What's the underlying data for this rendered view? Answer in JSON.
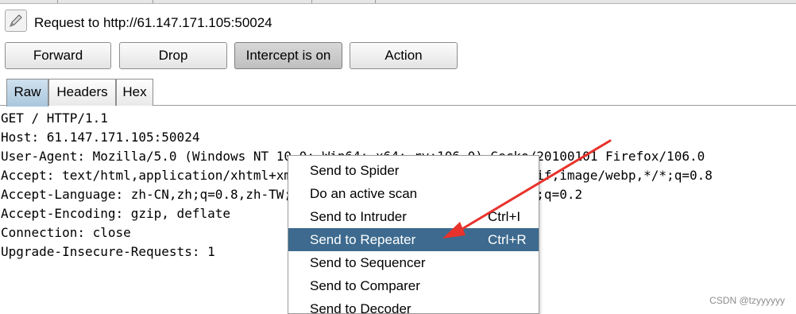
{
  "toolbar": {
    "title": "Request to http://61.147.171.105:50024",
    "forward_label": "Forward",
    "drop_label": "Drop",
    "intercept_label": "Intercept is on",
    "action_label": "Action"
  },
  "view_tabs": [
    {
      "label": "Raw",
      "selected": true
    },
    {
      "label": "Headers",
      "selected": false
    },
    {
      "label": "Hex",
      "selected": false
    }
  ],
  "request_lines": [
    "GET / HTTP/1.1",
    "Host: 61.147.171.105:50024",
    "User-Agent: Mozilla/5.0 (Windows NT 10.0; Win64; x64; rv:106.0) Gecko/20100101 Firefox/106.0",
    "Accept: text/html,application/xhtml+xml,application/xml;q=0.9,image/avif,image/webp,*/*;q=0.8",
    "Accept-Language: zh-CN,zh;q=0.8,zh-TW;q=0.7,zh-HK;q=0.5,en-US;q=0.3,en;q=0.2",
    "Accept-Encoding: gzip, deflate",
    "Connection: close",
    "Upgrade-Insecure-Requests: 1"
  ],
  "context_menu": [
    {
      "label": "Send to Spider",
      "shortcut": "",
      "highlighted": false
    },
    {
      "label": "Do an active scan",
      "shortcut": "",
      "highlighted": false
    },
    {
      "label": "Send to Intruder",
      "shortcut": "Ctrl+I",
      "highlighted": false
    },
    {
      "label": "Send to Repeater",
      "shortcut": "Ctrl+R",
      "highlighted": true
    },
    {
      "label": "Send to Sequencer",
      "shortcut": "",
      "highlighted": false
    },
    {
      "label": "Send to Comparer",
      "shortcut": "",
      "highlighted": false
    },
    {
      "label": "Send to Decoder",
      "shortcut": "",
      "highlighted": false
    }
  ],
  "annotation": {
    "color": "#e8322b"
  },
  "colors": {
    "menu_highlight": "#3d6a8e",
    "selected_tab": "#b9d1e4"
  },
  "watermark": "CSDN @tzyyyyyy"
}
